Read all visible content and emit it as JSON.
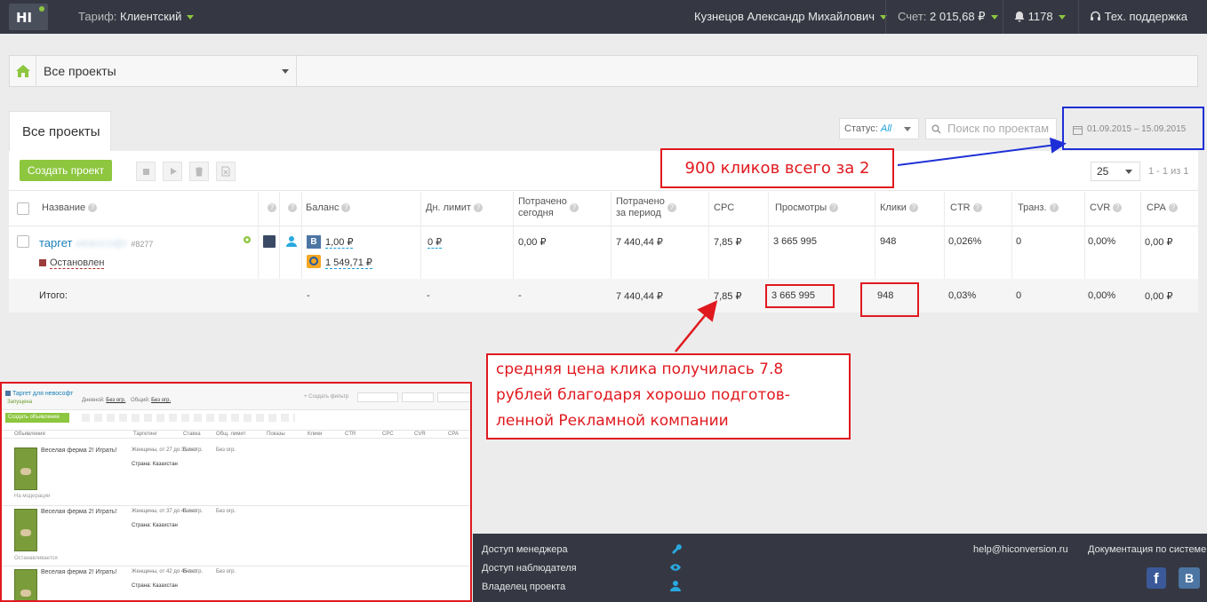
{
  "header": {
    "logo": "HI",
    "tariff_label": "Тариф:",
    "tariff_value": "Клиентский",
    "user_name": "Кузнецов Александр Михайлович",
    "account_label": "Счет:",
    "account_value": "2 015,68 ₽",
    "notifications": "1178",
    "support": "Тех. поддержка"
  },
  "project_bar": {
    "selected": "Все проекты"
  },
  "tabs": {
    "active": "Все проекты"
  },
  "filters": {
    "status_label": "Статус:",
    "status_value": "All",
    "search_placeholder": "Поиск по проектам",
    "date_range": "01.09.2015 – 15.09.2015"
  },
  "toolbar": {
    "create_label": "Создать проект",
    "per_page": "25",
    "pagination": "1 - 1 из 1"
  },
  "table": {
    "columns": {
      "name": "Название",
      "balance": "Баланс",
      "daily_limit": "Дн. лимит",
      "spent_today_1": "Потрачено",
      "spent_today_2": "сегодня",
      "spent_period_1": "Потрачено",
      "spent_period_2": "за период",
      "cpc": "CPC",
      "views": "Просмотры",
      "clicks": "Клики",
      "ctr": "CTR",
      "trans": "Транз.",
      "cvr": "CVR",
      "cpa": "CPA"
    },
    "row": {
      "name": "таргет",
      "name_blurred": "невософт",
      "id": "#8277",
      "status": "Остановлен",
      "balance_vk_badge": "В",
      "balance_vk": "1,00 ₽",
      "balance_mytarget": "1 549,71 ₽",
      "daily_limit": "0 ₽",
      "spent_today": "0,00 ₽",
      "spent_period": "7 440,44 ₽",
      "cpc": "7,85 ₽",
      "views": "3 665 995",
      "clicks": "948",
      "ctr": "0,026%",
      "trans": "0",
      "cvr": "0,00%",
      "cpa": "0,00 ₽"
    },
    "total": {
      "label": "Итого:",
      "balance": "-",
      "daily_limit": "-",
      "spent_today": "-",
      "spent_period": "7 440,44 ₽",
      "cpc": "7,85 ₽",
      "views": "3 665 995",
      "clicks": "948",
      "ctr": "0,03%",
      "trans": "0",
      "cvr": "0,00%",
      "cpa": "0,00 ₽"
    }
  },
  "annotations": {
    "clicks_note": "900 кликов всего за 2",
    "cpc_note_1": "средняя цена клика получилась 7.8",
    "cpc_note_2": "рублей благодаря хорошо подготов-",
    "cpc_note_3": "ленной Рекламной компании"
  },
  "footer": {
    "manager_access": "Доступ менеджера",
    "observer_access": "Доступ наблюдателя",
    "owner": "Владелец проекта",
    "email": "help@hiconversion.ru",
    "docs": "Документация по системе",
    "vk_badge": "В"
  },
  "thumbnail": {
    "title": "Таргет для невософт",
    "status": "Запущена",
    "create_filter": "Создать фильтр",
    "create_ad": "Создать объявление",
    "daily": "Дневной:",
    "total": "Общий:",
    "no_limit": "Без огр.",
    "columns": [
      "Объявления",
      "Таргетинг",
      "Ставка",
      "Общ. лимит",
      "Показы",
      "Клики",
      "CTR",
      "CPC",
      "CVR",
      "CPA"
    ],
    "ads": [
      {
        "title": "Веселая ферма 2! Играть!",
        "target": "Женщины, от 27 до 31 лет",
        "country": "Страна: Казахстан",
        "state": "На модерации"
      },
      {
        "title": "Веселая ферма 2! Играть!",
        "target": "Женщины, от 37 до 41 лет",
        "country": "Страна: Казахстан",
        "state": "Останавливается"
      },
      {
        "title": "Веселая ферма 2! Играть!",
        "target": "Женщины, от 42 до 45 лет",
        "country": "Страна: Казахстан",
        "state": ""
      }
    ]
  }
}
